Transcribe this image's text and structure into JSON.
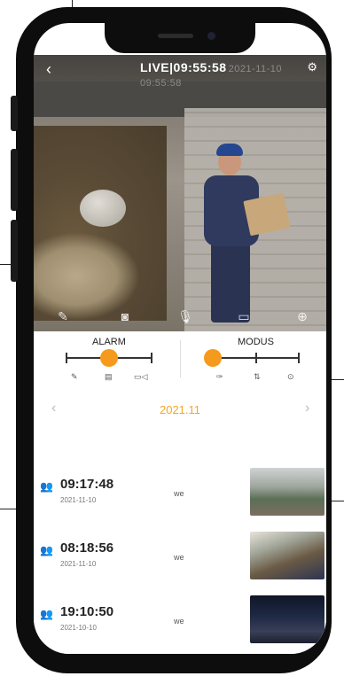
{
  "player": {
    "back_icon": "chevron-left-icon",
    "live_label": "LIVE|09:55:58",
    "live_date": "2021-11-10 09:55:58"
  },
  "video_controls": [
    "microphone-off-icon",
    "camera-icon",
    "microphone-icon",
    "record-icon",
    "fullscreen-icon"
  ],
  "alarm": {
    "title": "ALARM",
    "selected_index": 1,
    "icons": [
      "edit-icon",
      "message-icon",
      "video-message-icon"
    ]
  },
  "modus": {
    "title": "MODUS",
    "selected_index": 0,
    "icons": [
      "wrench-icon",
      "signal-icon",
      "location-icon"
    ]
  },
  "calendar": {
    "month": "2021.11",
    "prev_icon": "chevron-left-icon",
    "next_icon": "chevron-right-icon"
  },
  "events": [
    {
      "time": "09:17:48",
      "date": "2021-11-10",
      "who": "we"
    },
    {
      "time": "08:18:56",
      "date": "2021-11-10",
      "who": "we"
    },
    {
      "time": "19:10:50",
      "date": "2021-10-10",
      "who": "we"
    }
  ],
  "colors": {
    "accent": "#f5a623",
    "knob": "#f59a1d"
  }
}
